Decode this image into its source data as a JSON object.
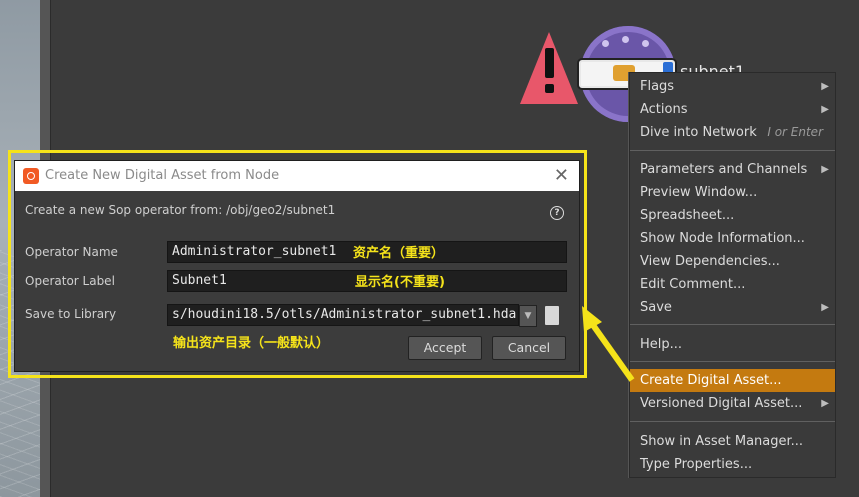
{
  "node": {
    "name": "subnet1"
  },
  "context_menu": {
    "items": [
      {
        "label": "Flags",
        "submenu": true
      },
      {
        "label": "Actions",
        "submenu": true
      },
      {
        "label": "Dive into Network",
        "shortcut": "I or Enter"
      },
      {
        "label": "Parameters and Channels",
        "submenu": true
      },
      {
        "label": "Preview Window..."
      },
      {
        "label": "Spreadsheet..."
      },
      {
        "label": "Show Node Information..."
      },
      {
        "label": "View Dependencies..."
      },
      {
        "label": "Edit Comment..."
      },
      {
        "label": "Save",
        "submenu": true
      },
      {
        "label": "Help..."
      },
      {
        "label": "Create Digital Asset...",
        "highlighted": true
      },
      {
        "label": "Versioned Digital Asset...",
        "submenu": true
      },
      {
        "label": "Show in Asset Manager..."
      },
      {
        "label": "Type Properties..."
      }
    ]
  },
  "dialog": {
    "title": "Create New Digital Asset from Node",
    "description": "Create a new Sop operator from: /obj/geo2/subnet1",
    "operator_name_label": "Operator Name",
    "operator_name_value": "Administrator_subnet1",
    "operator_label_label": "Operator Label",
    "operator_label_value": "Subnet1",
    "save_to_library_label": "Save to Library",
    "save_to_library_value": "s/houdini18.5/otls/Administrator_subnet1.hda",
    "accept_label": "Accept",
    "cancel_label": "Cancel"
  },
  "annotations": {
    "asset_name": "资产名（重要）",
    "display_name": "显示名(不重要)",
    "output_dir": "输出资产目录（一般默认）"
  },
  "colors": {
    "annotation_yellow": "#f5e31a",
    "highlight_orange": "#c47a10",
    "houdini_orange": "#f15a24",
    "warning_red": "#e8576a",
    "node_purple": "#6a56a8"
  }
}
